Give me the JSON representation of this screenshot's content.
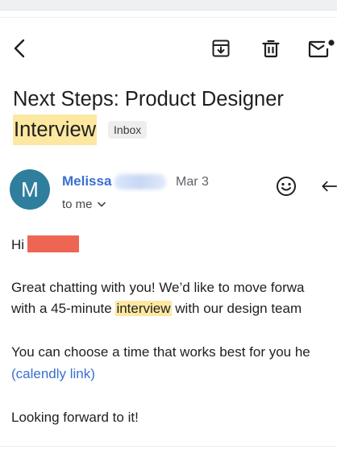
{
  "email": {
    "subject_part1": "Next Steps: Product Designer",
    "subject_part2": "Interview",
    "label": "Inbox",
    "sender": {
      "initial": "M",
      "name": "Melissa",
      "date": "Mar 3",
      "recipient": "to me"
    },
    "body": {
      "greeting": "Hi",
      "line1": "Great chatting with you! We’d like to move forwa",
      "line2_before": "with a 45-minute ",
      "line2_highlight": "interview",
      "line2_after": " with our design team",
      "line3": "You can choose a time that works best for you he",
      "link_text": "(calendly link)",
      "closing": "Looking forward to it!"
    }
  },
  "colors": {
    "avatar": "#2f7e9d",
    "sender_name": "#3a6fd0",
    "highlight": "#fce8a1",
    "redaction": "#ee6653",
    "link": "#3a6fd0"
  },
  "icons": [
    "back-arrow-icon",
    "archive-icon",
    "trash-icon",
    "mail-icon",
    "emoji-icon",
    "reply-icon",
    "chevron-down-icon"
  ]
}
